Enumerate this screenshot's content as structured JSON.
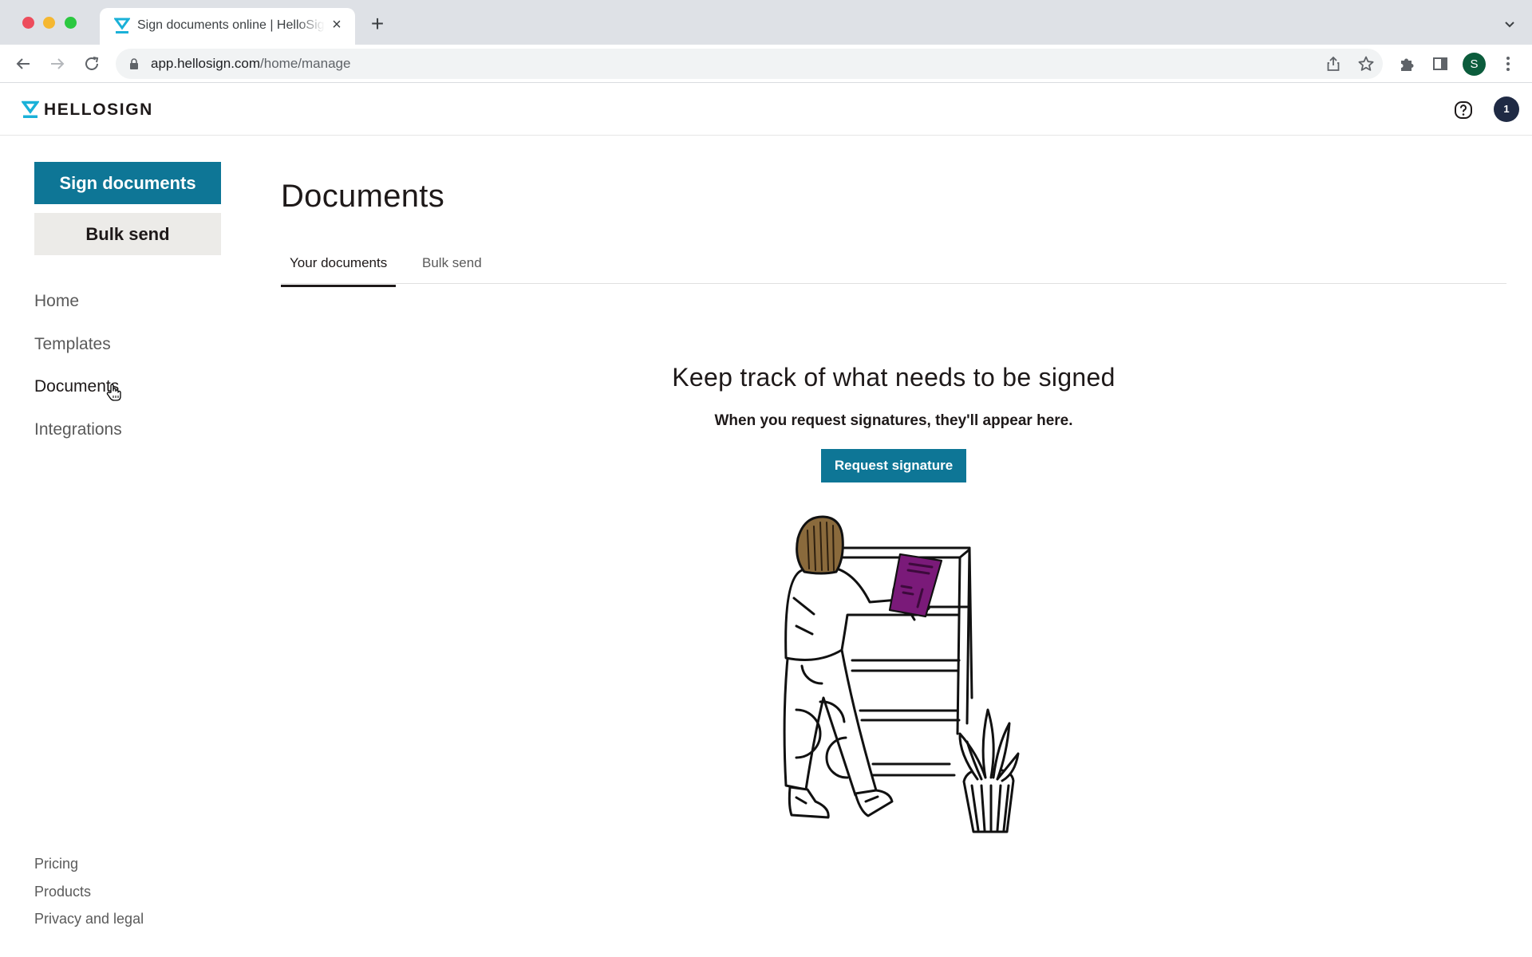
{
  "browser": {
    "tab_title": "Sign documents online | HelloSign",
    "url_domain": "app.hellosign.com",
    "url_path": "/home/manage",
    "profile_initial": "S",
    "new_tab_label": "+",
    "close_tab_label": "×"
  },
  "header": {
    "logo_text": "HELLOSIGN",
    "user_badge": "1",
    "colors": {
      "brand_cyan": "#1ab1d8",
      "avatar_navy": "#1f2a44"
    }
  },
  "sidebar": {
    "primary_button": "Sign documents",
    "secondary_button": "Bulk send",
    "nav": [
      {
        "label": "Home",
        "active": false
      },
      {
        "label": "Templates",
        "active": false
      },
      {
        "label": "Documents",
        "active": true
      },
      {
        "label": "Integrations",
        "active": false
      }
    ],
    "footer_links": [
      {
        "label": "Pricing"
      },
      {
        "label": "Products"
      },
      {
        "label": "Privacy and legal"
      }
    ],
    "colors": {
      "primary": "#0e7696",
      "secondary_bg": "#ecebe8"
    }
  },
  "main": {
    "title": "Documents",
    "tabs": [
      {
        "label": "Your documents",
        "active": true
      },
      {
        "label": "Bulk send",
        "active": false
      }
    ],
    "empty_state": {
      "heading": "Keep track of what needs to be signed",
      "subtext": "When you request signatures, they'll appear here.",
      "button": "Request signature",
      "illustration": "person-placing-folder-on-shelf-with-plant"
    }
  }
}
